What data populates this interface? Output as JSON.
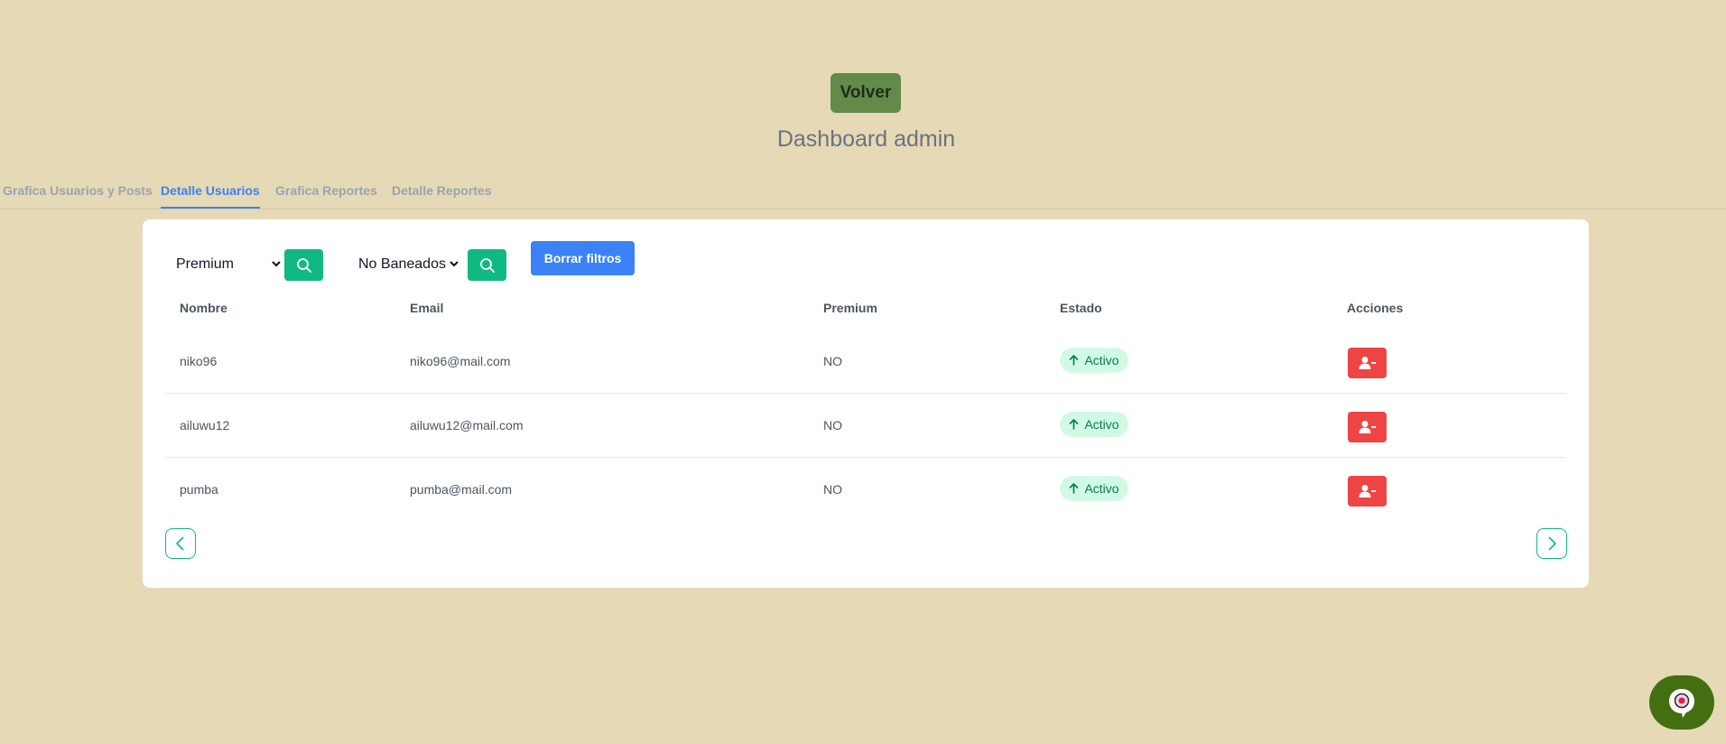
{
  "header": {
    "back_label": "Volver",
    "title": "Dashboard admin"
  },
  "tabs": [
    {
      "label": "Grafica Usuarios y Posts",
      "active": false
    },
    {
      "label": "Detalle Usuarios",
      "active": true
    },
    {
      "label": "Grafica Reportes",
      "active": false
    },
    {
      "label": "Detalle Reportes",
      "active": false
    }
  ],
  "filters": {
    "premium_select": "Premium",
    "ban_select": "No Baneados",
    "clear_label": "Borrar filtros"
  },
  "table": {
    "columns": [
      "Nombre",
      "Email",
      "Premium",
      "Estado",
      "Acciones"
    ],
    "rows": [
      {
        "nombre": "niko96",
        "email": "niko96@mail.com",
        "premium": "NO",
        "estado": "Activo"
      },
      {
        "nombre": "ailuwu12",
        "email": "ailuwu12@mail.com",
        "premium": "NO",
        "estado": "Activo"
      },
      {
        "nombre": "pumba",
        "email": "pumba@mail.com",
        "premium": "NO",
        "estado": "Activo"
      }
    ]
  },
  "icons": {
    "search": "search-icon",
    "ban_user": "user-minus-icon",
    "status": "arrow-up-icon",
    "prev": "chevron-left-icon",
    "next": "chevron-right-icon",
    "chat": "chat-bot-icon"
  },
  "colors": {
    "background": "#e5d9b6",
    "back_button": "#628b4a",
    "accent_blue": "#3b82f6",
    "accent_green": "#10b981",
    "danger": "#ef4444",
    "chat": "#436f10"
  }
}
